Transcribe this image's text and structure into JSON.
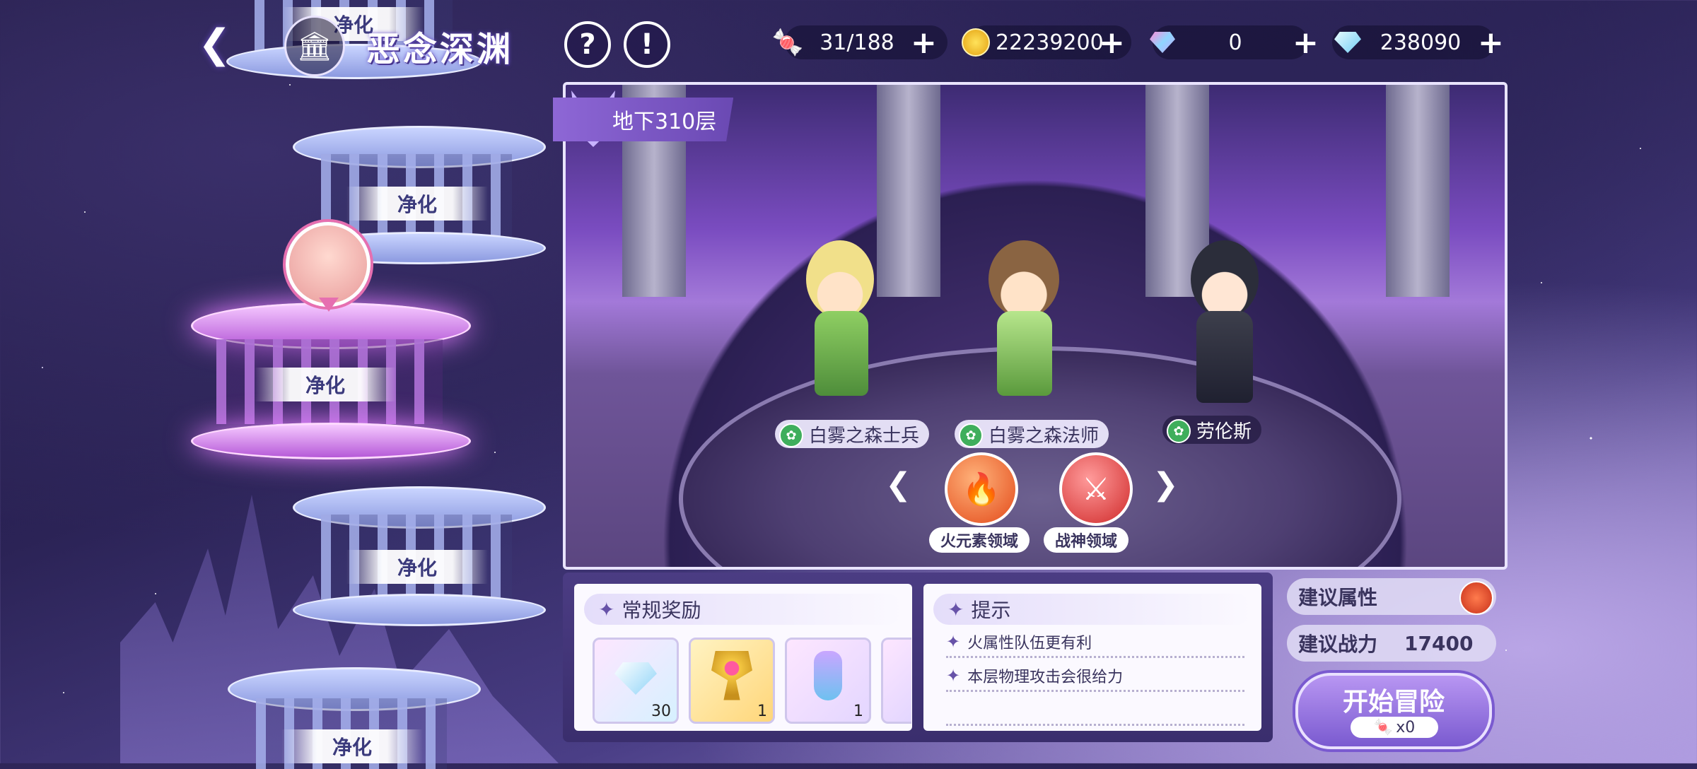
{
  "header": {
    "title": "恶念深渊",
    "help_icon": "question-icon",
    "notice_icon": "exclamation-icon"
  },
  "resources": [
    {
      "name": "stamina",
      "icon": "candy-icon",
      "value": "31/188"
    },
    {
      "name": "gold",
      "icon": "coin-icon",
      "value": "22239200"
    },
    {
      "name": "paid_gem",
      "icon": "rainbow-gem-icon",
      "value": "0"
    },
    {
      "name": "gem",
      "icon": "diamond-icon",
      "value": "238090"
    }
  ],
  "floors": [
    {
      "label": "净化",
      "state": "cleared"
    },
    {
      "label": "净化",
      "state": "cleared"
    },
    {
      "label": "净化",
      "state": "current"
    },
    {
      "label": "净化",
      "state": "cleared"
    },
    {
      "label": "净化",
      "state": "cleared"
    }
  ],
  "stage": {
    "floor_badge": "地下310层",
    "enemies": [
      {
        "name": "白雾之森士兵",
        "element_color": "#3fae5c"
      },
      {
        "name": "白雾之森法师",
        "element_color": "#3fae5c"
      },
      {
        "name": "劳伦斯",
        "element_color": "#3fae5c"
      }
    ],
    "domains": [
      {
        "label": "火元素领域",
        "icon": "fire-icon"
      },
      {
        "label": "战神领域",
        "icon": "sword-icon"
      }
    ]
  },
  "rewards": {
    "title": "常规奖励",
    "items": [
      {
        "icon": "diamond-icon",
        "count": "30"
      },
      {
        "icon": "golden-crest-icon",
        "count": "1"
      },
      {
        "icon": "potion-icon",
        "count": "1"
      }
    ]
  },
  "tips": {
    "title": "提示",
    "lines": [
      "火属性队伍更有利",
      "本层物理攻击会很给力"
    ]
  },
  "suggestions": {
    "attr_label": "建议属性",
    "attr_icon": "fire-icon",
    "power_label": "建议战力",
    "power_value": "17400"
  },
  "start": {
    "label": "开始冒险",
    "cost": "x0"
  },
  "colors": {
    "accent": "#7a5ad0",
    "current_floor": "#e47dff",
    "wind_element": "#3fae5c"
  }
}
